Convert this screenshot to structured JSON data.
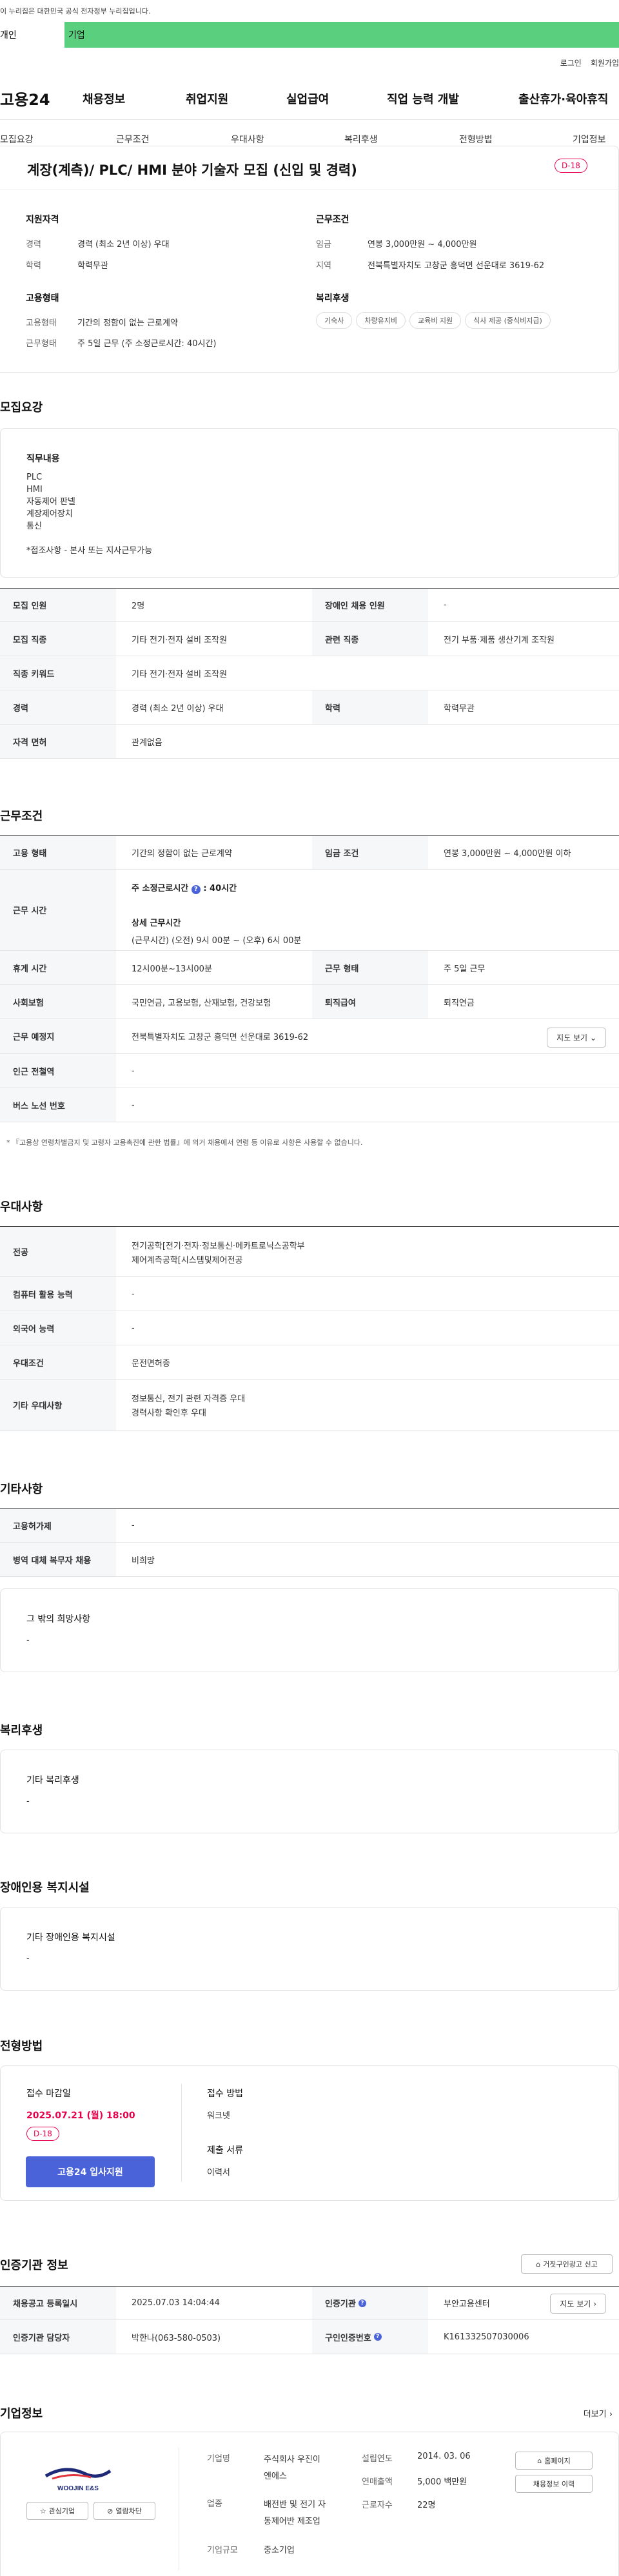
{
  "gov_banner": "이 누리집은 대한민국 공식 전자정부 누리집입니다.",
  "user_tabs": [
    "개인",
    "기업"
  ],
  "top_links": [
    "로그인",
    "회원가입"
  ],
  "logo": "고용24",
  "gnb": [
    "채용정보",
    "취업지원",
    "실업급여",
    "직업 능력 개발",
    "출산휴가·육아휴직"
  ],
  "tabs": [
    "모집요강",
    "근무조건",
    "우대사항",
    "복리후생",
    "전형방법",
    "기업정보"
  ],
  "summary": {
    "title": "계장(계측)/ PLC/ HMI 분야 기술자 모집 (신입 및 경력)",
    "dday": "D-18",
    "qual_h": "지원자격",
    "career_l": "경력",
    "career_v": "경력 (최소 2년 이상) 우대",
    "edu_l": "학력",
    "edu_v": "학력무관",
    "cond_h": "근무조건",
    "wage_l": "임금",
    "wage_v": "연봉 3,000만원 ~ 4,000만원",
    "area_l": "지역",
    "area_v": "전북특별자치도 고창군 흥덕면 선운대로 3619-62",
    "emp_h": "고용형태",
    "emptype_l": "고용형태",
    "emptype_v": "기간의 정함이 없는 근로계약",
    "worktype_l": "근무형태",
    "worktype_v": "주 5일 근무 (주 소정근로시간: 40시간)",
    "welfare_h": "복리후생",
    "welfare_tags": [
      "기숙사",
      "차량유지비",
      "교육비 지원",
      "식사 제공 (중식비지급)"
    ]
  },
  "recruit": {
    "h": "모집요강",
    "duty_h": "직무내용",
    "duty_lines": [
      "PLC",
      "HMI",
      "자동제어 판넬",
      "계장제어장치",
      "통신",
      "",
      "*접조사항 - 본사 또는 지사근무가능"
    ],
    "rows": [
      {
        "l1": "모집 인원",
        "v1": "2명",
        "l2": "장애인 채용 인원",
        "v2": "-"
      },
      {
        "l1": "모집 직종",
        "v1": "기타 전기·전자 설비 조작원",
        "l2": "관련 직종",
        "v2": "전기 부품·제품 생산기계 조작원"
      },
      {
        "l1": "직종 키워드",
        "v1": "기타 전기·전자 설비 조작원"
      },
      {
        "l1": "경력",
        "v1": "경력 (최소 2년 이상) 우대",
        "l2": "학력",
        "v2": "학력무관"
      },
      {
        "l1": "자격 면허",
        "v1": "관계없음"
      }
    ]
  },
  "conditions": {
    "h": "근무조건",
    "emp_l": "고용 형태",
    "emp_v": "기간의 정함이 없는 근로계약",
    "wage_l": "임금 조건",
    "wage_v": "연봉 3,000만원 ~ 4,000만원 이하",
    "time_l": "근무 시간",
    "time_main": "주 소정근로시간",
    "time_main_v": ": 40시간",
    "time_detail_h": "상세 근무시간",
    "time_detail_v": "(근무시간) (오전) 9시 00분 ~ (오후) 6시 00분",
    "break_l": "휴게 시간",
    "break_v": "12시00분~13시00분",
    "form_l": "근무 형태",
    "form_v": "주 5일 근무",
    "ins_l": "사회보험",
    "ins_v": "국민연금, 고용보험, 산재보험, 건강보험",
    "sev_l": "퇴직급여",
    "sev_v": "퇴직연금",
    "place_l": "근무 예정지",
    "place_v": "전북특별자치도 고창군 흥덕면 선운대로 3619-62",
    "map_btn": "지도 보기",
    "subway_l": "인근 전철역",
    "subway_v": "-",
    "bus_l": "버스 노선 번호",
    "bus_v": "-",
    "note": "* 『고용상 연령차별금지 및 고령자 고용촉진에 관한 법률』에 의거 채용에서 연령 등 이유로 사항은 사용할 수 없습니다."
  },
  "preference": {
    "h": "우대사항",
    "major_l": "전공",
    "major_v1": "전기공학[전기·전자·정보통신·메카트로닉스공학부",
    "major_v2": "제어계측공학[시스템및제어전공",
    "pc_l": "컴퓨터 활용 능력",
    "pc_v": "-",
    "lang_l": "외국어 능력",
    "lang_v": "-",
    "cond_l": "우대조건",
    "cond_v": "운전면허증",
    "etc_l": "기타 우대사항",
    "etc_v1": "정보통신, 전기 관련 자격증 우대",
    "etc_v2": "경력사항 확인후 우대"
  },
  "other": {
    "h": "기타사항",
    "emp_l": "고용허가제",
    "emp_v": "-",
    "mil_l": "병역 대체 복무자 채용",
    "mil_v": "비희망",
    "hope_h": "그 밖의 희망사항",
    "hope_v": "-"
  },
  "welfare": {
    "h": "복리후생",
    "etc_h": "기타 복리후생",
    "etc_v": "-"
  },
  "disabled": {
    "h": "장애인용 복지시설",
    "etc_h": "기타 장애인용 복지시설",
    "etc_v": "-"
  },
  "process": {
    "h": "전형방법",
    "deadline_h": "접수 마감일",
    "deadline_v": "2025.07.21 (월) 18:00",
    "dday": "D-18",
    "apply_btn": "고용24 입사지원",
    "method_h": "접수 방법",
    "method_v": "워크넷",
    "docs_h": "제출 서류",
    "docs_v": "이력서"
  },
  "cert": {
    "h": "인증기관 정보",
    "report_btn": "거짓구인광고 신고",
    "reg_l": "채용공고 등록일시",
    "reg_v": "2025.07.03 14:04:44",
    "org_l": "인증기관",
    "org_v": "부안고용센터",
    "map_btn": "지도 보기",
    "staff_l": "인증기관 담당자",
    "staff_v": "박한나(063-580-0503)",
    "id_l": "구인인증번호",
    "id_v": "K161332507030006"
  },
  "company": {
    "h": "기업정보",
    "more": "더보기",
    "logo_text": "WOOJIN E&S",
    "fav_btn": "관심기업",
    "block_btn": "열람차단",
    "name_l": "기업명",
    "name_v1": "주식회사 우진이",
    "name_v2": "엔에스",
    "ind_l": "업종",
    "ind_v1": "배전반 및 전기 자",
    "ind_v2": "동제어반 제조업",
    "size_l": "기업규모",
    "size_v": "중소기업",
    "est_l": "설립연도",
    "est_v": "2014. 03. 06",
    "rev_l": "연매출액",
    "rev_v": "5,000 백만원",
    "emp_l": "근로자수",
    "emp_v": "22명",
    "home_btn": "홈페이지",
    "list_btn": "채용정보 이력"
  }
}
